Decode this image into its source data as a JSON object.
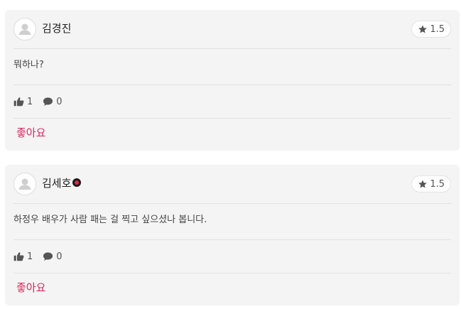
{
  "comments": [
    {
      "author": "김경진",
      "has_badge": false,
      "rating": "1.5",
      "text": "뭐하나?",
      "likes": "1",
      "replies": "0",
      "like_button_label": "좋아요"
    },
    {
      "author": "김세호",
      "has_badge": true,
      "rating": "1.5",
      "text": "하정우 배우가 사람 패는 걸 찍고 싶으셨나 봅니다.",
      "likes": "1",
      "replies": "0",
      "like_button_label": "좋아요"
    }
  ],
  "icons": {
    "avatar": "user-silhouette-icon",
    "rating": "star-icon",
    "likes": "thumbs-up-icon",
    "replies": "speech-bubble-icon"
  },
  "colors": {
    "accent": "#e0245e",
    "card_bg": "#f4f4f4",
    "badge": "#e0254a"
  }
}
